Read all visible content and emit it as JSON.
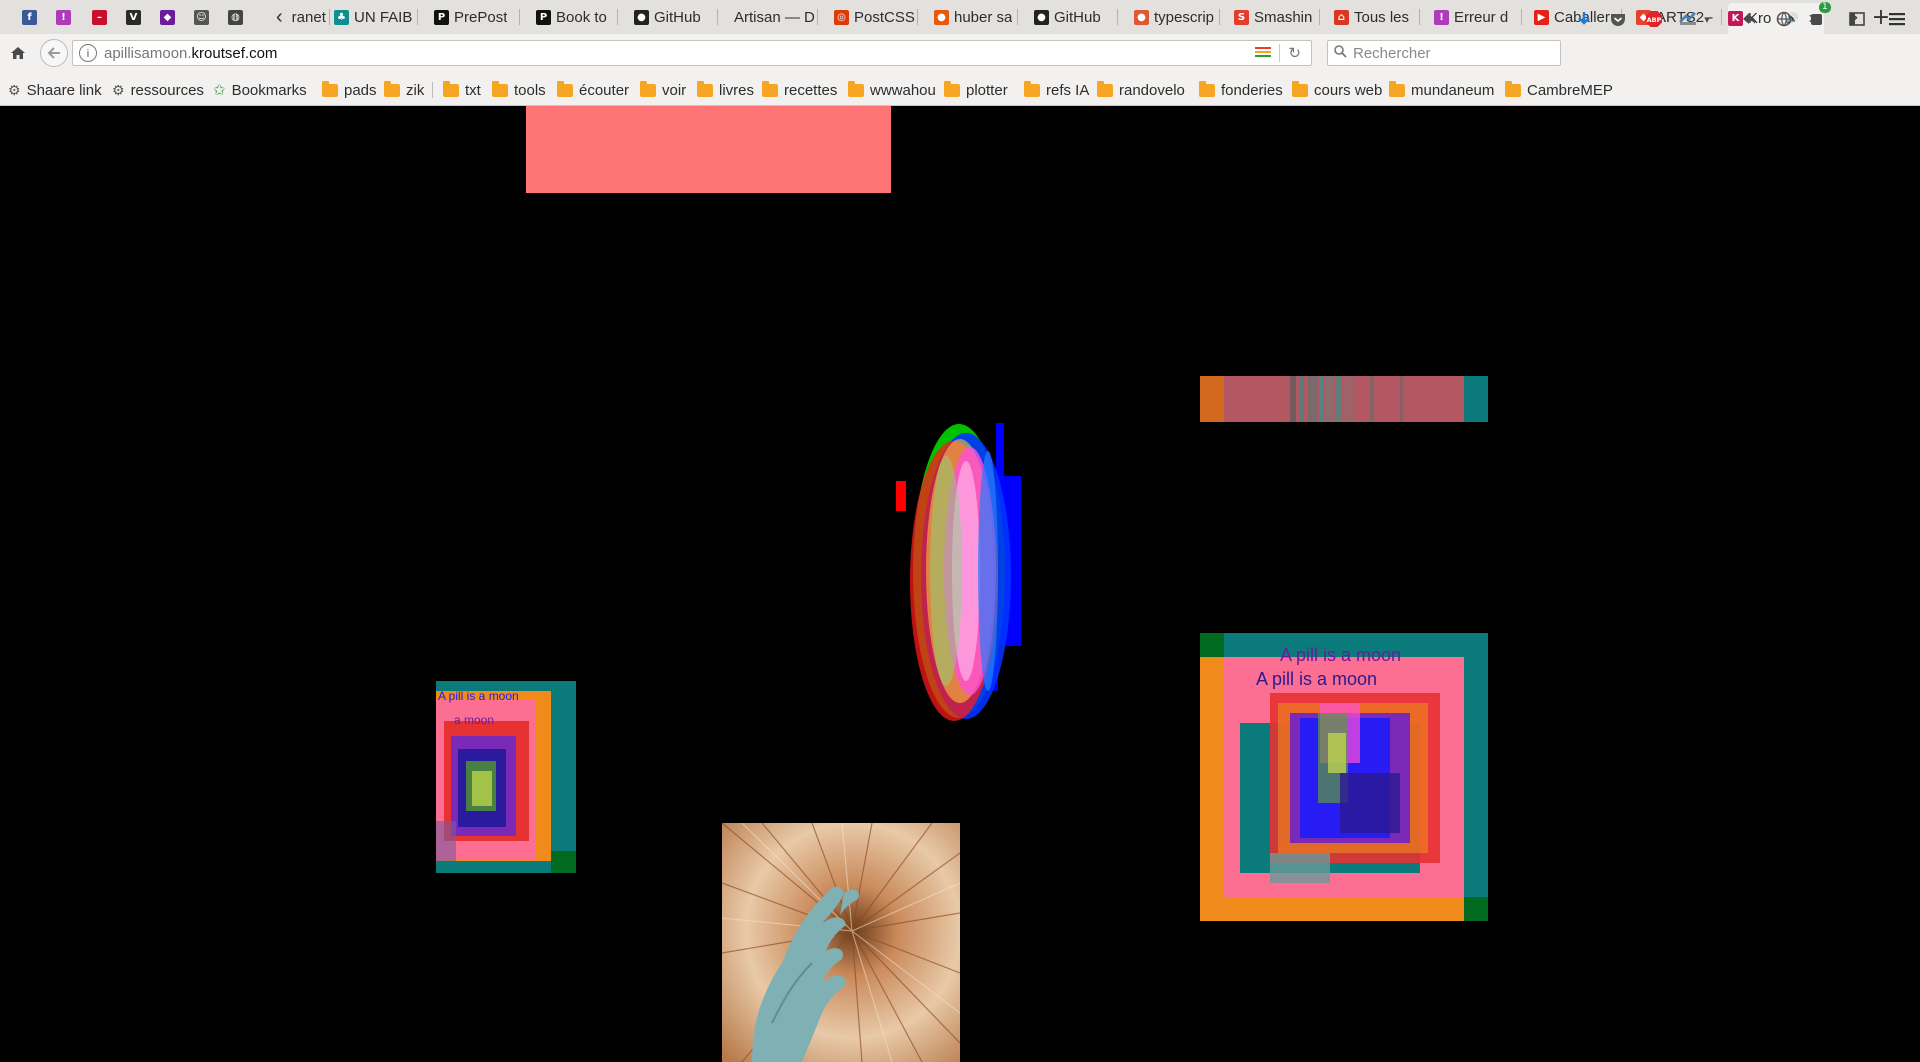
{
  "browser": {
    "tabs": [
      {
        "title": "",
        "favicon": "facebook-icon",
        "color": "#3b5998"
      },
      {
        "title": "",
        "favicon": "exclamation-icon",
        "color": "#b03bb8"
      },
      {
        "title": "",
        "favicon": "red-dash-icon",
        "color": "#c8102e"
      },
      {
        "title": "",
        "favicon": "v-icon",
        "color": "#2a2a2a"
      },
      {
        "title": "",
        "favicon": "diamond-icon",
        "color": "#6a1b9a"
      },
      {
        "title": "",
        "favicon": "robot-icon",
        "color": "#555555"
      },
      {
        "title": "",
        "favicon": "globe-icon",
        "color": "#444444"
      },
      {
        "title": "ranet",
        "favicon": "",
        "color": ""
      },
      {
        "title": "UN FAIB",
        "favicon": "tree-icon",
        "color": "#0b8f8f"
      },
      {
        "title": "PrePost",
        "favicon": "pp-icon",
        "color": "#111111"
      },
      {
        "title": "Book to",
        "favicon": "p-icon",
        "color": "#111111"
      },
      {
        "title": "GitHub",
        "favicon": "github-icon",
        "color": "#222222"
      },
      {
        "title": "Artisan — D",
        "favicon": "",
        "color": ""
      },
      {
        "title": "PostCSS",
        "favicon": "postcss-icon",
        "color": "#dd3a0a"
      },
      {
        "title": "huber sa",
        "favicon": "circle-icon",
        "color": "#e8590c"
      },
      {
        "title": "GitHub",
        "favicon": "github-icon",
        "color": "#222222"
      },
      {
        "title": "typescrip",
        "favicon": "duckduckgo-icon",
        "color": "#de5833"
      },
      {
        "title": "Smashin",
        "favicon": "smashing-icon",
        "color": "#e53d2b"
      },
      {
        "title": "Tous les",
        "favicon": "house-icon",
        "color": "#d9381e"
      },
      {
        "title": "Erreur d",
        "favicon": "exclamation-icon",
        "color": "#b03bb8"
      },
      {
        "title": "Caballer",
        "favicon": "youtube-icon",
        "color": "#e62117"
      },
      {
        "title": "ARTS2 -",
        "favicon": "gitlab-icon",
        "color": "#e2432a"
      },
      {
        "title": "Kro",
        "favicon": "kroutsef-icon",
        "color": "#c2185b"
      }
    ],
    "url": {
      "prefix": "apillisamoon.",
      "domain": "kroutsef.com"
    },
    "search_placeholder": "Rechercher",
    "notification_count": "1",
    "bookmarks": [
      {
        "label": "Shaare link",
        "icon": "gear-icon"
      },
      {
        "label": "ressources",
        "icon": "gear-icon"
      },
      {
        "label": "Bookmarks",
        "icon": "star-icon"
      },
      {
        "label": "pads",
        "icon": "folder-icon"
      },
      {
        "label": "zik",
        "icon": "folder-icon"
      },
      {
        "label": "txt",
        "icon": "folder-icon"
      },
      {
        "label": "tools",
        "icon": "folder-icon"
      },
      {
        "label": "écouter",
        "icon": "folder-icon"
      },
      {
        "label": "voir",
        "icon": "folder-icon"
      },
      {
        "label": "livres",
        "icon": "folder-icon"
      },
      {
        "label": "recettes",
        "icon": "folder-icon"
      },
      {
        "label": "wwwahou",
        "icon": "folder-icon"
      },
      {
        "label": "plotter",
        "icon": "folder-icon"
      },
      {
        "label": "refs IA",
        "icon": "folder-icon"
      },
      {
        "label": "randovelo",
        "icon": "folder-icon"
      },
      {
        "label": "fonderies",
        "icon": "folder-icon"
      },
      {
        "label": "cours web",
        "icon": "folder-icon"
      },
      {
        "label": "mundaneum",
        "icon": "folder-icon"
      },
      {
        "label": "CambreMEP",
        "icon": "folder-icon"
      }
    ]
  },
  "page": {
    "background": "#000000",
    "pill_text": "A pill is a moon",
    "pill_text_partial": "a moon",
    "colors": {
      "salmon": "#ff7575",
      "teal": "#0a7a7a",
      "orange": "#f08a1a",
      "pink": "#ff6aa8",
      "blue": "#1a1aff",
      "green": "#00b050"
    }
  }
}
